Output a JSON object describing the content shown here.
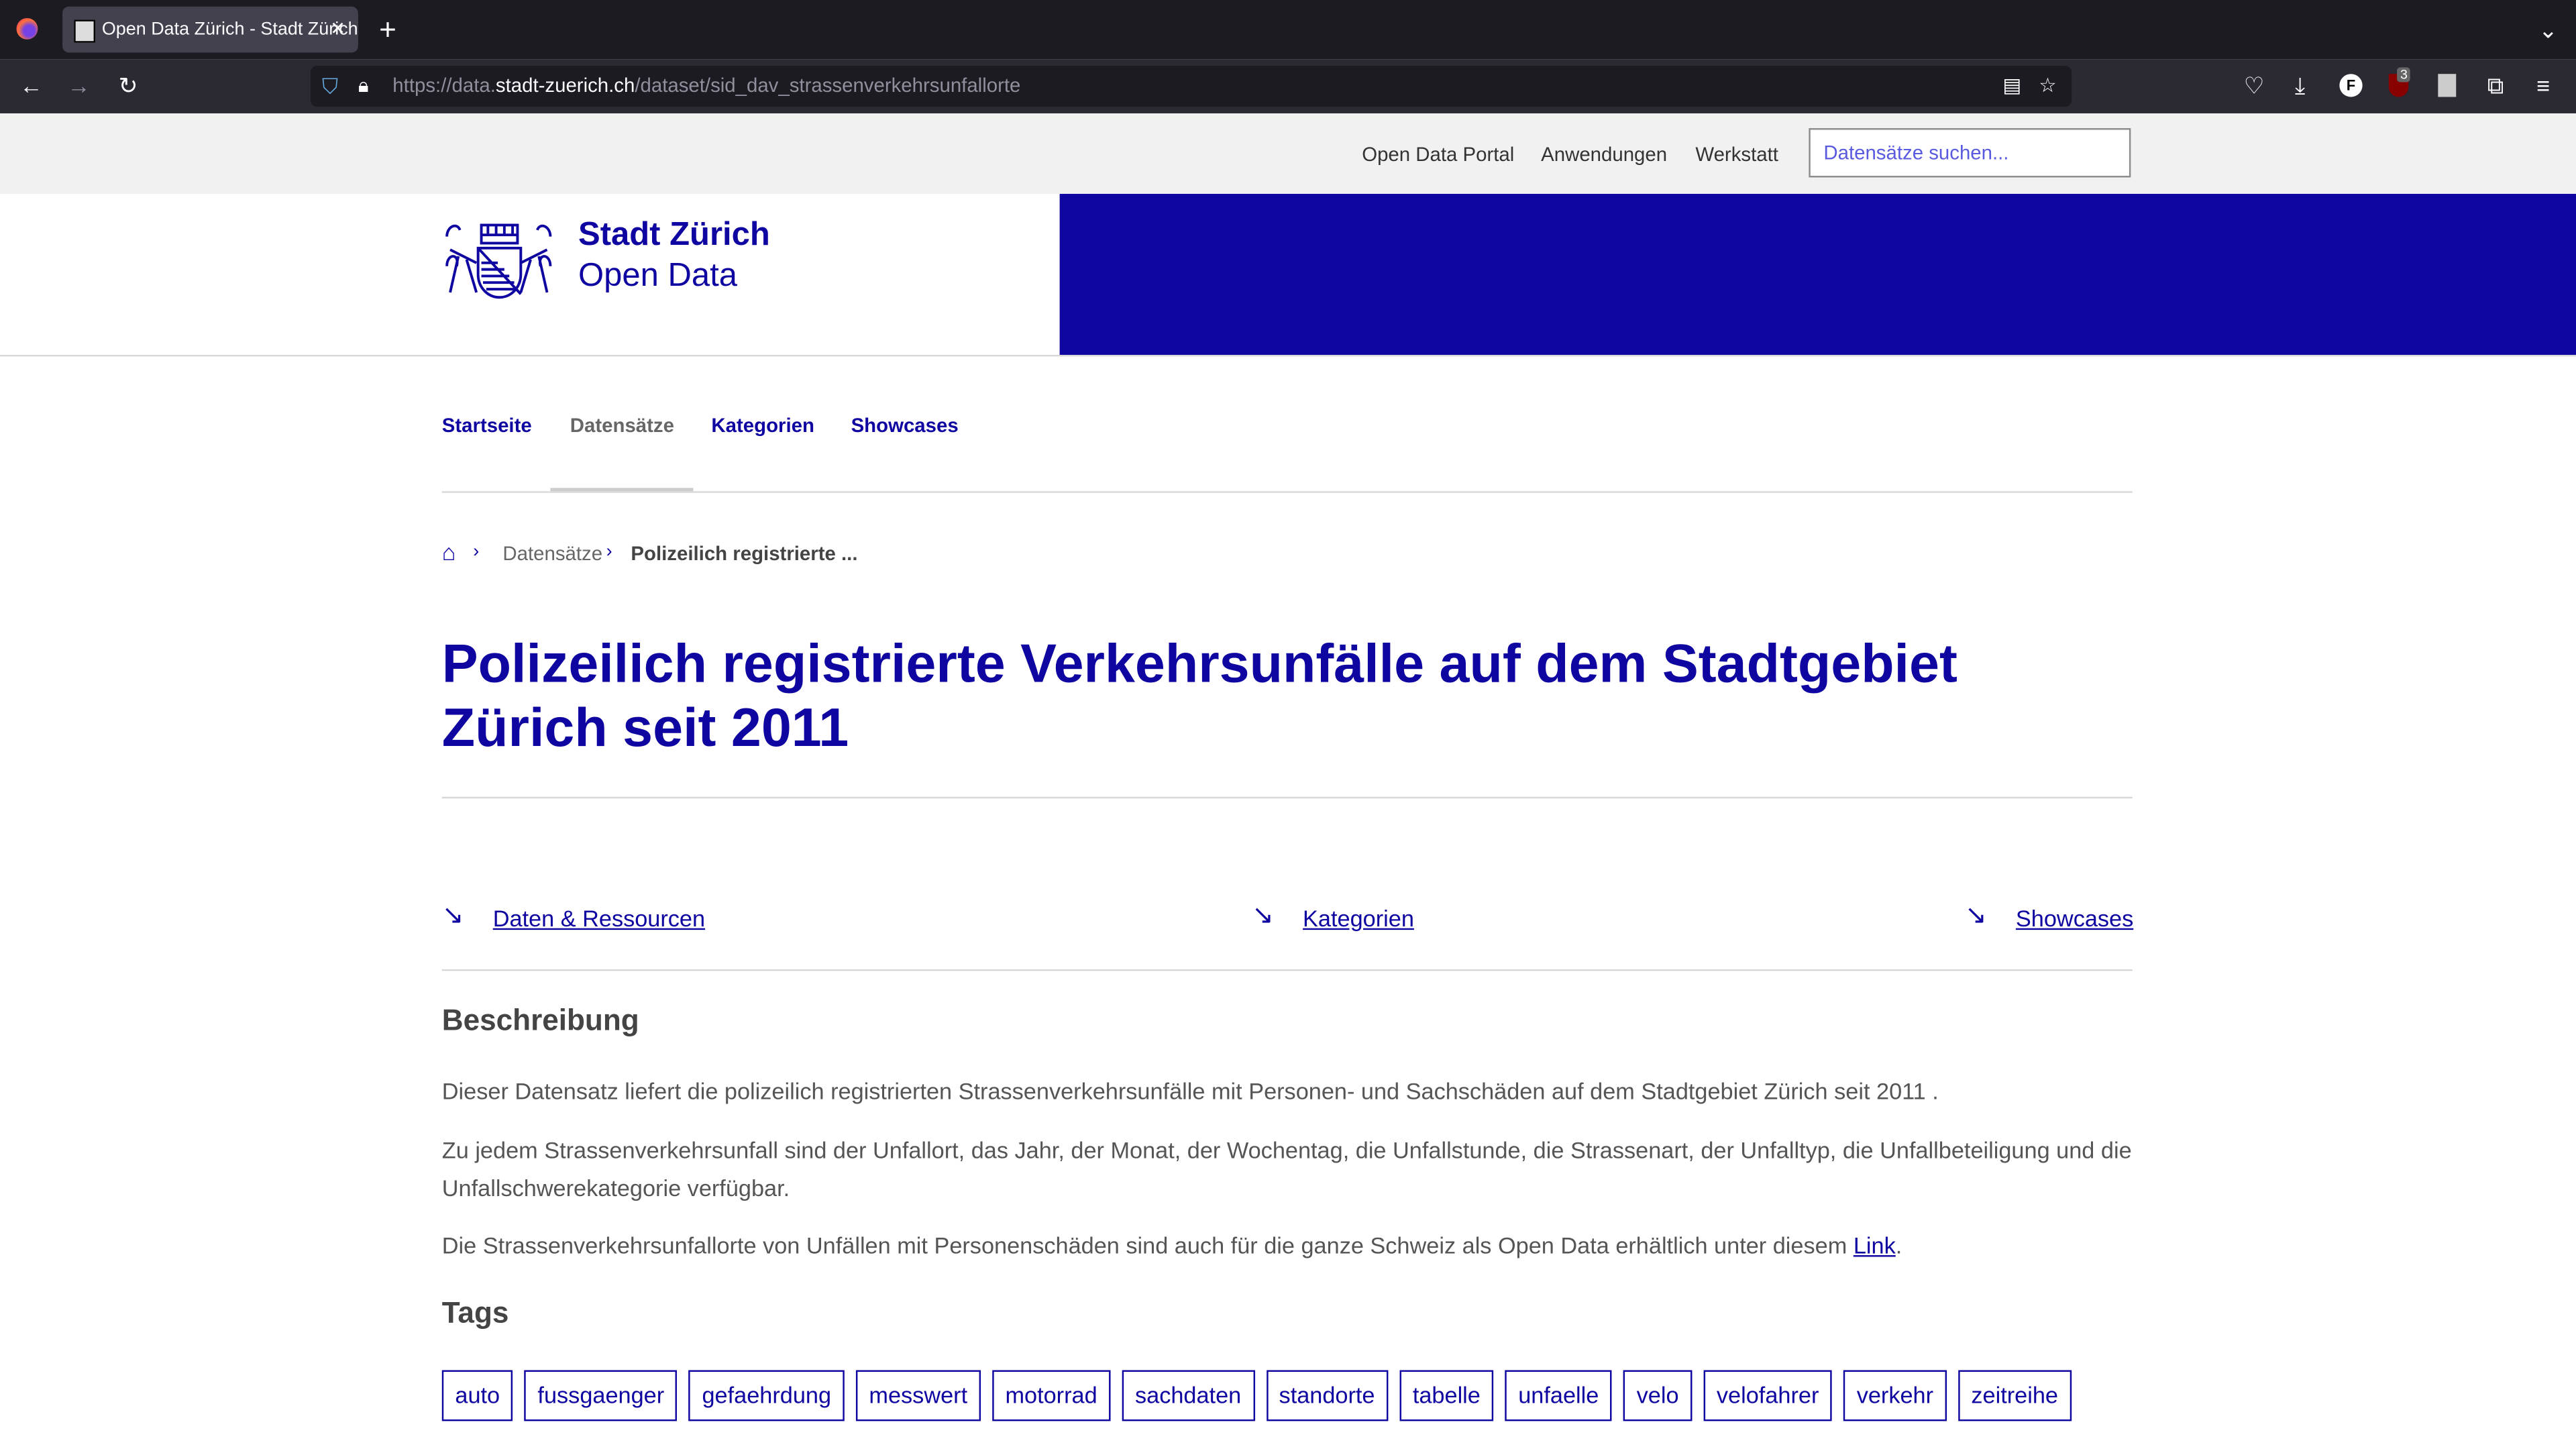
{
  "browser": {
    "tab_title": "Open Data Zürich - Stadt Zürich",
    "url_prefix": "https://data.",
    "url_domain": "stadt-zuerich.ch",
    "url_path": "/dataset/sid_dav_strassenverkehrsunfallorte",
    "ublock_count": "3",
    "profile_letter": "F"
  },
  "topnav": {
    "items": [
      "Open Data Portal",
      "Anwendungen",
      "Werkstatt"
    ],
    "search_placeholder": "Datensätze suchen..."
  },
  "brand": {
    "title": "Stadt Zürich",
    "subtitle": "Open Data",
    "color": "#0f05a0"
  },
  "mainnav": {
    "items": [
      "Startseite",
      "Datensätze",
      "Kategorien",
      "Showcases"
    ],
    "active": "Datensätze"
  },
  "breadcrumb": {
    "items": [
      "Datensätze",
      "Polizeilich registrierte ..."
    ]
  },
  "page": {
    "title": "Polizeilich registrierte Verkehrsunfälle auf dem Stadtgebiet Zürich seit 2011"
  },
  "anchors": [
    "Daten & Ressourcen",
    "Kategorien",
    "Showcases"
  ],
  "description": {
    "heading": "Beschreibung",
    "p1": "Dieser Datensatz liefert die polizeilich registrierten Strassenverkehrsunfälle mit Personen- und Sachschäden auf dem Stadtgebiet Zürich seit 2011 .",
    "p2": "Zu jedem Strassenverkehrsunfall sind der Unfallort, das Jahr, der Monat, der Wochentag, die Unfallstunde, die Strassenart, der Unfalltyp, die Unfallbeteiligung und die Unfallschwerekategorie verfügbar.",
    "p3_text": "Die Strassenverkehrsunfallorte von Unfällen mit Personenschäden sind auch für die ganze Schweiz als Open Data erhältlich unter diesem ",
    "p3_link": "Link",
    "p3_end": "."
  },
  "tags": {
    "heading": "Tags",
    "items": [
      "auto",
      "fussgaenger",
      "gefaehrdung",
      "messwert",
      "motorrad",
      "sachdaten",
      "standorte",
      "tabelle",
      "unfaelle",
      "velo",
      "velofahrer",
      "verkehr",
      "zeitreihe"
    ]
  }
}
